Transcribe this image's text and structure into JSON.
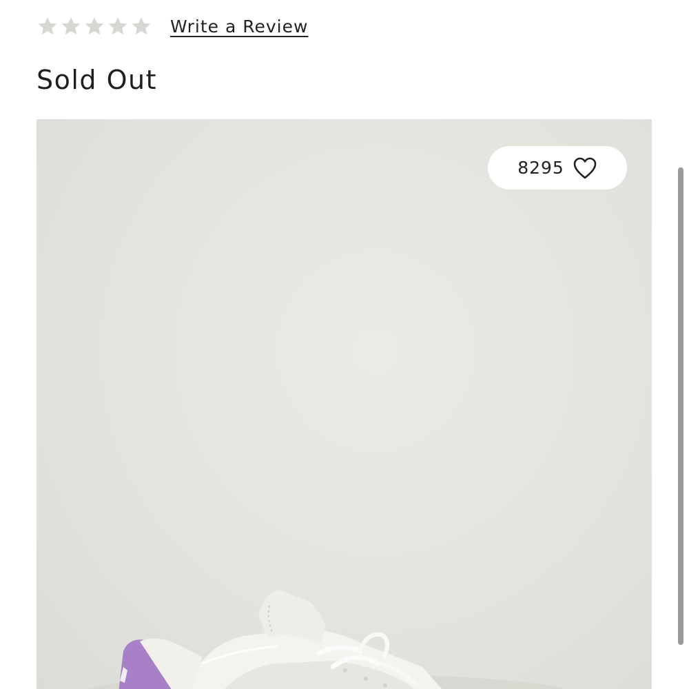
{
  "reviews": {
    "rating": 0,
    "max_rating": 5,
    "write_review_label": "Write a Review"
  },
  "product": {
    "status": "Sold Out",
    "likes": "8295",
    "accent_color": "#a780c8",
    "background_color": "#e3e3de"
  },
  "icons": {
    "star": "star-icon",
    "heart": "heart-outline-icon"
  }
}
